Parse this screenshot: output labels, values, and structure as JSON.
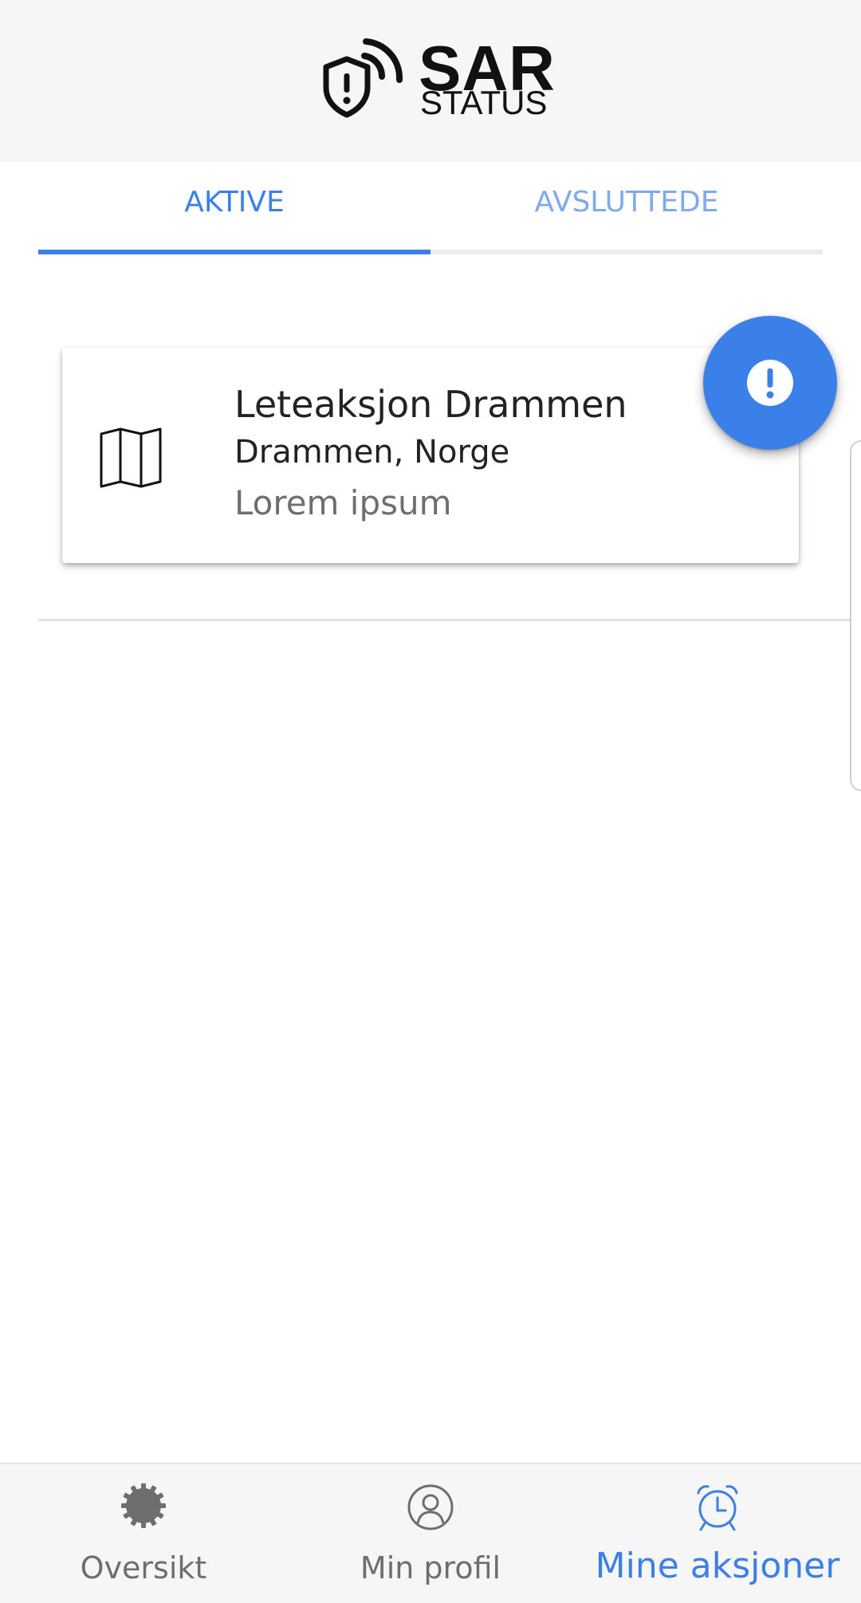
{
  "app": {
    "logo_title": "SAR",
    "logo_subtitle": "STATUS"
  },
  "tabs": [
    {
      "label": "AKTIVE",
      "active": true
    },
    {
      "label": "AVSLUTTEDE",
      "active": false
    }
  ],
  "cards": [
    {
      "icon": "map-icon",
      "title": "Leteaksjon Drammen",
      "location": "Drammen, Norge",
      "description": "Lorem ipsum"
    }
  ],
  "fab": {
    "icon": "alert-exclamation-icon"
  },
  "bottom_nav": [
    {
      "label": "Oversikt",
      "icon": "gear-icon",
      "active": false
    },
    {
      "label": "Min profil",
      "icon": "profile-icon",
      "active": false
    },
    {
      "label": "Mine aksjoner",
      "icon": "alarm-clock-icon",
      "active": true
    }
  ],
  "colors": {
    "accent": "#3b7fe9",
    "accent_light": "#7fa9f0",
    "header_bg": "#f6f6f6",
    "muted_text": "#6e6e6e"
  }
}
